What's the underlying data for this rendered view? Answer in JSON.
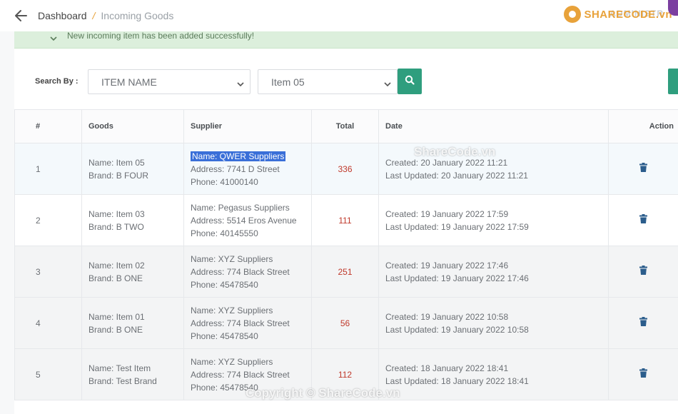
{
  "breadcrumb": {
    "home": "Dashboard",
    "separator": "/",
    "current": "Incoming Goods"
  },
  "brand": {
    "name": "SHARECODE.vn",
    "ghost": "ADMINISTR"
  },
  "alert": {
    "text": "New incoming item has been added successfully!"
  },
  "search": {
    "label": "Search By :",
    "field_value": "ITEM NAME",
    "item_value": "Item 05"
  },
  "table": {
    "headers": {
      "num": "#",
      "goods": "Goods",
      "supplier": "Supplier",
      "total": "Total",
      "date": "Date",
      "action": "Action"
    },
    "rows": [
      {
        "num": "1",
        "goods_name": "Name: Item 05",
        "goods_brand": "Brand: B FOUR",
        "supplier_name": "Name: QWER Suppliers",
        "supplier_address": "Address: 7741 D Street",
        "supplier_phone": "Phone: 41000140",
        "total": "336",
        "created": "Created: 20 January 2022 11:21",
        "updated": "Last Updated: 20 January 2022 11:21"
      },
      {
        "num": "2",
        "goods_name": "Name: Item 03",
        "goods_brand": "Brand: B TWO",
        "supplier_name": "Name: Pegasus Suppliers",
        "supplier_address": "Address: 5514 Eros Avenue",
        "supplier_phone": "Phone: 40145550",
        "total": "111",
        "created": "Created: 19 January 2022 17:59",
        "updated": "Last Updated: 19 January 2022 17:59"
      },
      {
        "num": "3",
        "goods_name": "Name: Item 02",
        "goods_brand": "Brand: B ONE",
        "supplier_name": "Name: XYZ Suppliers",
        "supplier_address": "Address: 774 Black Street",
        "supplier_phone": "Phone: 45478540",
        "total": "251",
        "created": "Created: 19 January 2022 17:46",
        "updated": "Last Updated: 19 January 2022 17:46"
      },
      {
        "num": "4",
        "goods_name": "Name: Item 01",
        "goods_brand": "Brand: B ONE",
        "supplier_name": "Name: XYZ Suppliers",
        "supplier_address": "Address: 774 Black Street",
        "supplier_phone": "Phone: 45478540",
        "total": "56",
        "created": "Created: 19 January 2022 10:58",
        "updated": "Last Updated: 19 January 2022 10:58"
      },
      {
        "num": "5",
        "goods_name": "Name: Test Item",
        "goods_brand": "Brand: Test Brand",
        "supplier_name": "Name: XYZ Suppliers",
        "supplier_address": "Address: 774 Black Street",
        "supplier_phone": "Phone: 45478540",
        "total": "112",
        "created": "Created: 18 January 2022 18:41",
        "updated": "Last Updated: 18 January 2022 18:41"
      }
    ]
  },
  "watermarks": {
    "middle": "ShareCode.vn",
    "bottom": "Copyright © ShareCode.vn"
  },
  "colors": {
    "accent": "#2f9e7e",
    "total_text": "#c0392b",
    "alert_bg": "#dcefdc",
    "trash_icon": "#2b5d8c",
    "selection": "#3a6fd8",
    "brand": "#e8a23a"
  }
}
